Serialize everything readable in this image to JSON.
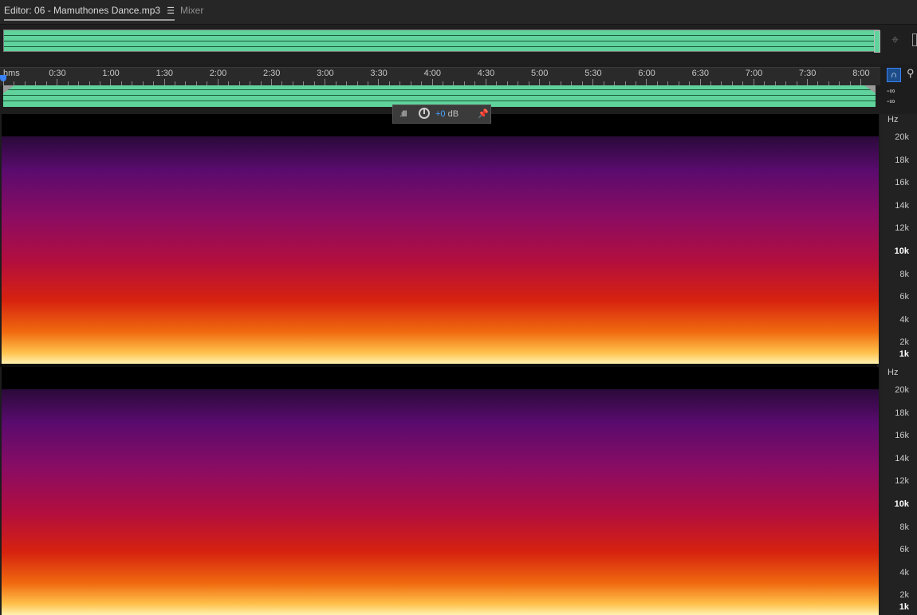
{
  "tabs": [
    {
      "label": "Editor: 06 - Mamuthones Dance.mp3",
      "active": true
    },
    {
      "label": "Mixer",
      "active": false
    }
  ],
  "icons": {
    "menu": "hamburger-menu-icon",
    "zoom": "zoom-icon",
    "snap": "snap-magnet-icon",
    "marker": "marker-pin-icon",
    "meter": "level-meter-icon",
    "knob": "volume-knob-icon",
    "pin": "pin-icon"
  },
  "ruler": {
    "unit": "hms",
    "labels": [
      "0:30",
      "1:00",
      "1:30",
      "2:00",
      "2:30",
      "3:00",
      "3:30",
      "4:00",
      "4:30",
      "5:00",
      "5:30",
      "6:00",
      "6:30",
      "7:00",
      "7:30",
      "8:00"
    ]
  },
  "levels": {
    "top": "-∞",
    "bottom": "-∞"
  },
  "hud": {
    "db_value": "+0",
    "db_unit": "dB"
  },
  "frequency_axis": {
    "unit": "Hz",
    "labels": [
      "20k",
      "18k",
      "16k",
      "14k",
      "12k",
      "10k",
      "8k",
      "6k",
      "4k",
      "2k",
      "1k"
    ],
    "bold": [
      "10k",
      "1k"
    ]
  },
  "colors": {
    "waveform": "#5fd39b",
    "accent": "#3b82f6"
  }
}
